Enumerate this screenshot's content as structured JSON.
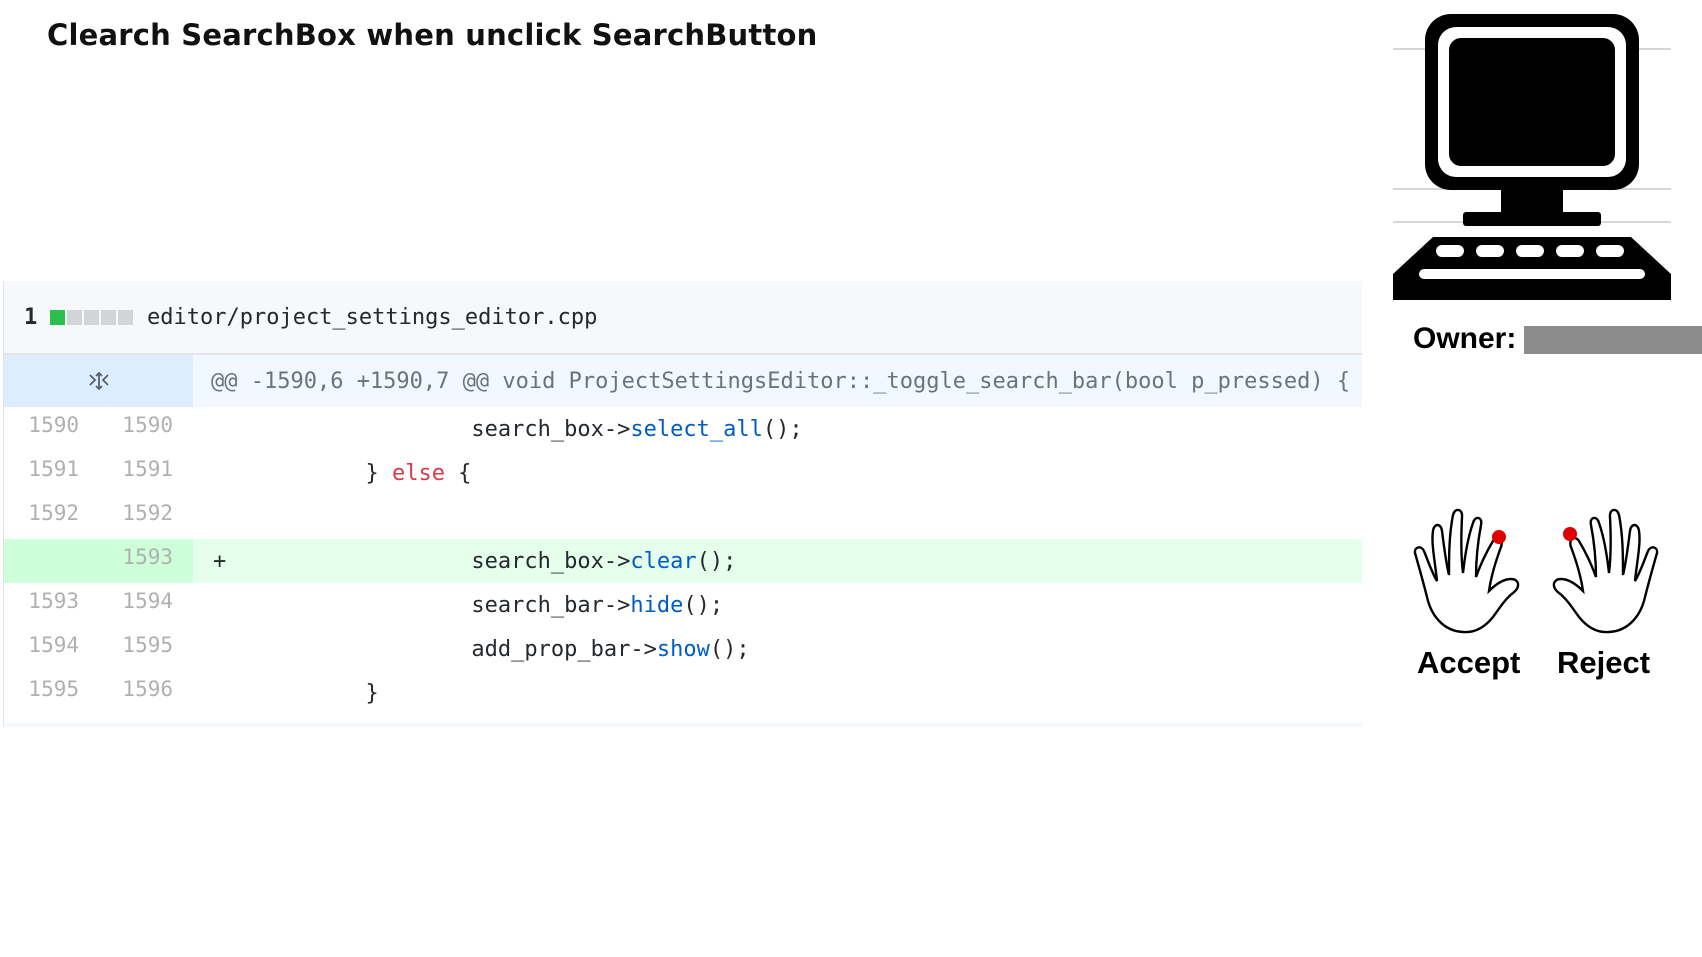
{
  "title": "Clearch SearchBox when unclick SearchButton",
  "file": {
    "changes": "1",
    "diffstat_colors": [
      "#2cbe4e",
      "#d1d5da",
      "#d1d5da",
      "#d1d5da",
      "#d1d5da"
    ],
    "path": "editor/project_settings_editor.cpp"
  },
  "hunk": {
    "expand_icon": "unfold-icon",
    "header": "@@ -1590,6 +1590,7 @@ void ProjectSettingsEditor::_toggle_search_bar(bool p_pressed) {"
  },
  "lines": [
    {
      "old": "1590",
      "new": "1590",
      "marker": "",
      "indent": "                  ",
      "text_a": "search_box->",
      "fn": "select_all",
      "text_b": "();"
    },
    {
      "old": "1591",
      "new": "1591",
      "marker": "",
      "indent": "          ",
      "text_a": "} ",
      "kw": "else",
      "text_b": " {"
    },
    {
      "old": "1592",
      "new": "1592",
      "marker": "",
      "indent": "",
      "text_a": "",
      "text_b": ""
    },
    {
      "old": "",
      "new": "1593",
      "marker": "+",
      "indent": "                  ",
      "text_a": "search_box->",
      "fn": "clear",
      "text_b": "();"
    },
    {
      "old": "1593",
      "new": "1594",
      "marker": "",
      "indent": "                  ",
      "text_a": "search_bar->",
      "fn": "hide",
      "text_b": "();"
    },
    {
      "old": "1594",
      "new": "1595",
      "marker": "",
      "indent": "                  ",
      "text_a": "add_prop_bar->",
      "fn": "show",
      "text_b": "();"
    },
    {
      "old": "1595",
      "new": "1596",
      "marker": "",
      "indent": "          ",
      "text_a": "}",
      "text_b": ""
    }
  ],
  "sidebar": {
    "computer_icon": "computer-icon",
    "owner_label": "Owner:",
    "accept_label": "Accept",
    "reject_label": "Reject"
  }
}
